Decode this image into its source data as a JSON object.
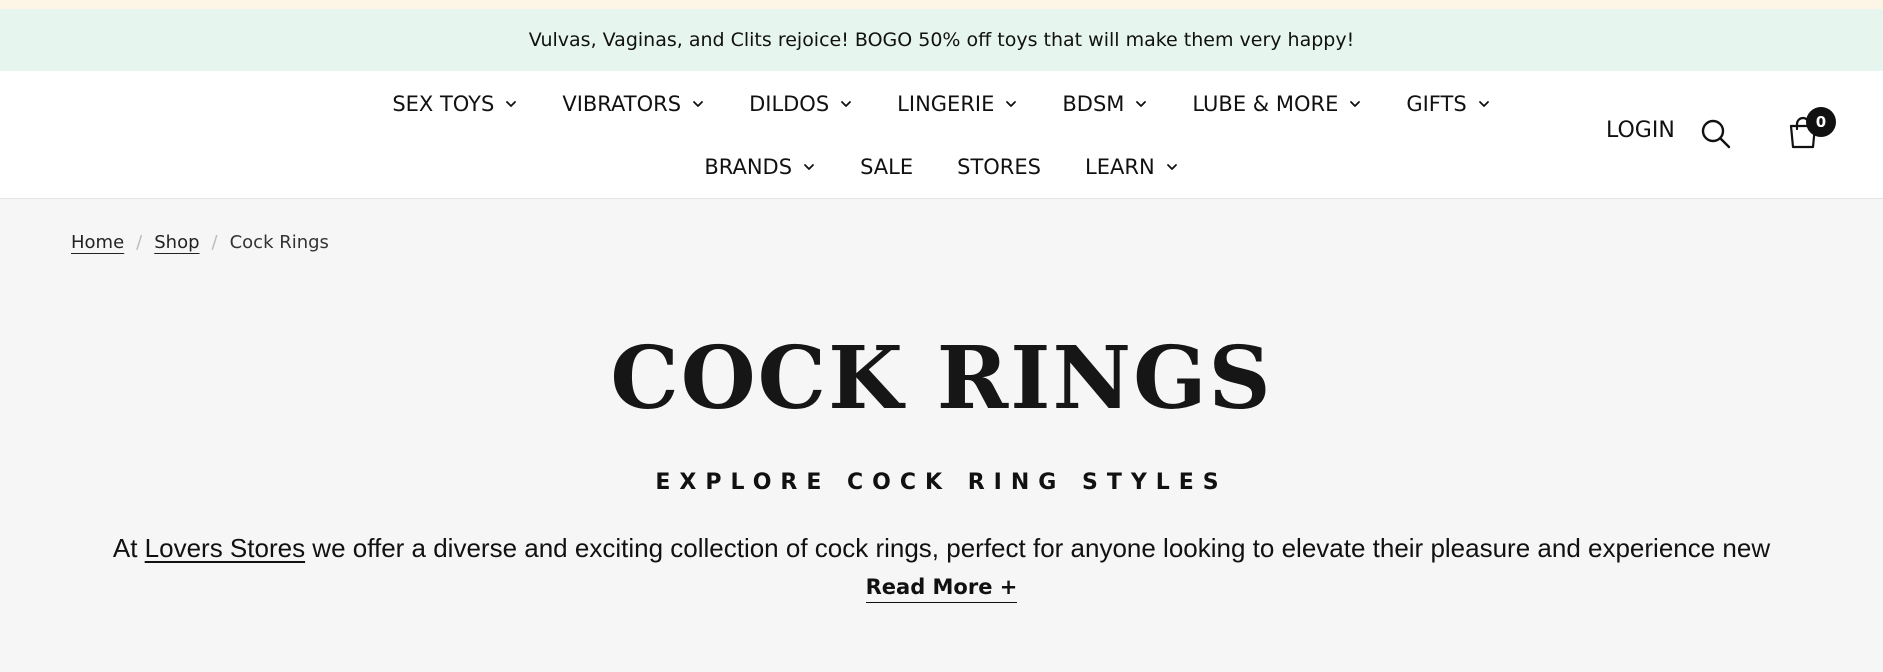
{
  "promo": {
    "text": "Vulvas, Vaginas, and Clits rejoice! BOGO 50% off toys that will make them very happy!"
  },
  "nav": {
    "row1": [
      {
        "label": "SEX TOYS",
        "dropdown": true
      },
      {
        "label": "VIBRATORS",
        "dropdown": true
      },
      {
        "label": "DILDOS",
        "dropdown": true
      },
      {
        "label": "LINGERIE",
        "dropdown": true
      },
      {
        "label": "BDSM",
        "dropdown": true
      },
      {
        "label": "LUBE & MORE",
        "dropdown": true
      },
      {
        "label": "GIFTS",
        "dropdown": true
      }
    ],
    "row2": [
      {
        "label": "BRANDS",
        "dropdown": true
      },
      {
        "label": "SALE",
        "dropdown": false
      },
      {
        "label": "STORES",
        "dropdown": false
      },
      {
        "label": "LEARN",
        "dropdown": true
      }
    ]
  },
  "header": {
    "login_label": "LOGIN",
    "cart_count": "0",
    "search_icon": "search-icon",
    "cart_icon": "shopping-bag-icon"
  },
  "breadcrumb": {
    "home": "Home",
    "shop": "Shop",
    "current": "Cock Rings",
    "separator": "/"
  },
  "main": {
    "title": "COCK RINGS",
    "subtitle": "EXPLORE COCK RING STYLES",
    "desc_before": "At ",
    "desc_link": "Lovers Stores",
    "desc_after": " we offer a diverse and exciting collection of cock rings, perfect for anyone looking to elevate their pleasure and experience new",
    "read_more": "Read More +"
  },
  "colors": {
    "promo_bg": "#e6f5ed",
    "page_bg": "#f6f6f6",
    "text": "#111111"
  }
}
